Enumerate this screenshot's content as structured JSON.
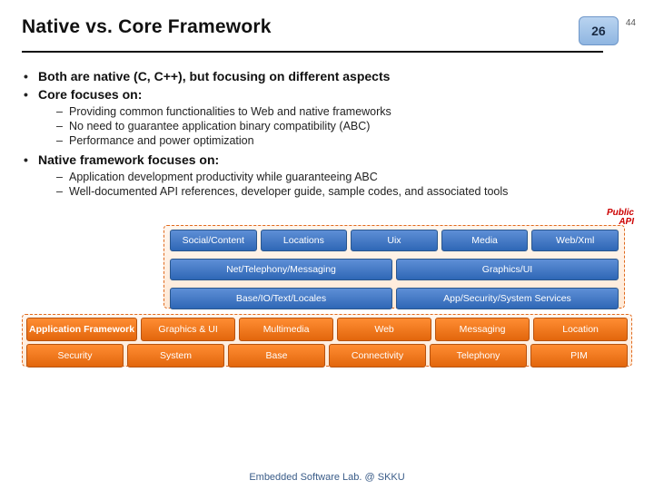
{
  "header": {
    "title": "Native vs. Core Framework",
    "page_badge": "26",
    "aux_number": "44"
  },
  "bullets": {
    "b1": "Both are native (C, C++), but focusing on different aspects",
    "b2": "Core focuses on:",
    "b2_sub1": "Providing common functionalities to Web and native frameworks",
    "b2_sub2": "No need to guarantee application binary compatibility (ABC)",
    "b2_sub3": "Performance and power optimization",
    "b3": "Native framework focuses on:",
    "b3_sub1": "Application development productivity while guaranteeing ABC",
    "b3_sub2": "Well-documented API references, developer guide, sample codes, and associated tools"
  },
  "diagram": {
    "public_api_line1": "Public",
    "public_api_line2": "API",
    "core_row1": [
      "Social/Content",
      "Locations",
      "Uix",
      "Media",
      "Web/Xml"
    ],
    "core_row2": [
      "Net/Telephony/Messaging",
      "Graphics/UI"
    ],
    "core_row3": [
      "Base/IO/Text/Locales",
      "App/Security/System Services"
    ],
    "native_row1": [
      "Application Framework",
      "Graphics & UI",
      "Multimedia",
      "Web",
      "Messaging",
      "Location"
    ],
    "native_row2": [
      "Security",
      "System",
      "Base",
      "Connectivity",
      "Telephony",
      "PIM"
    ]
  },
  "footer": "Embedded Software Lab. @ SKKU"
}
